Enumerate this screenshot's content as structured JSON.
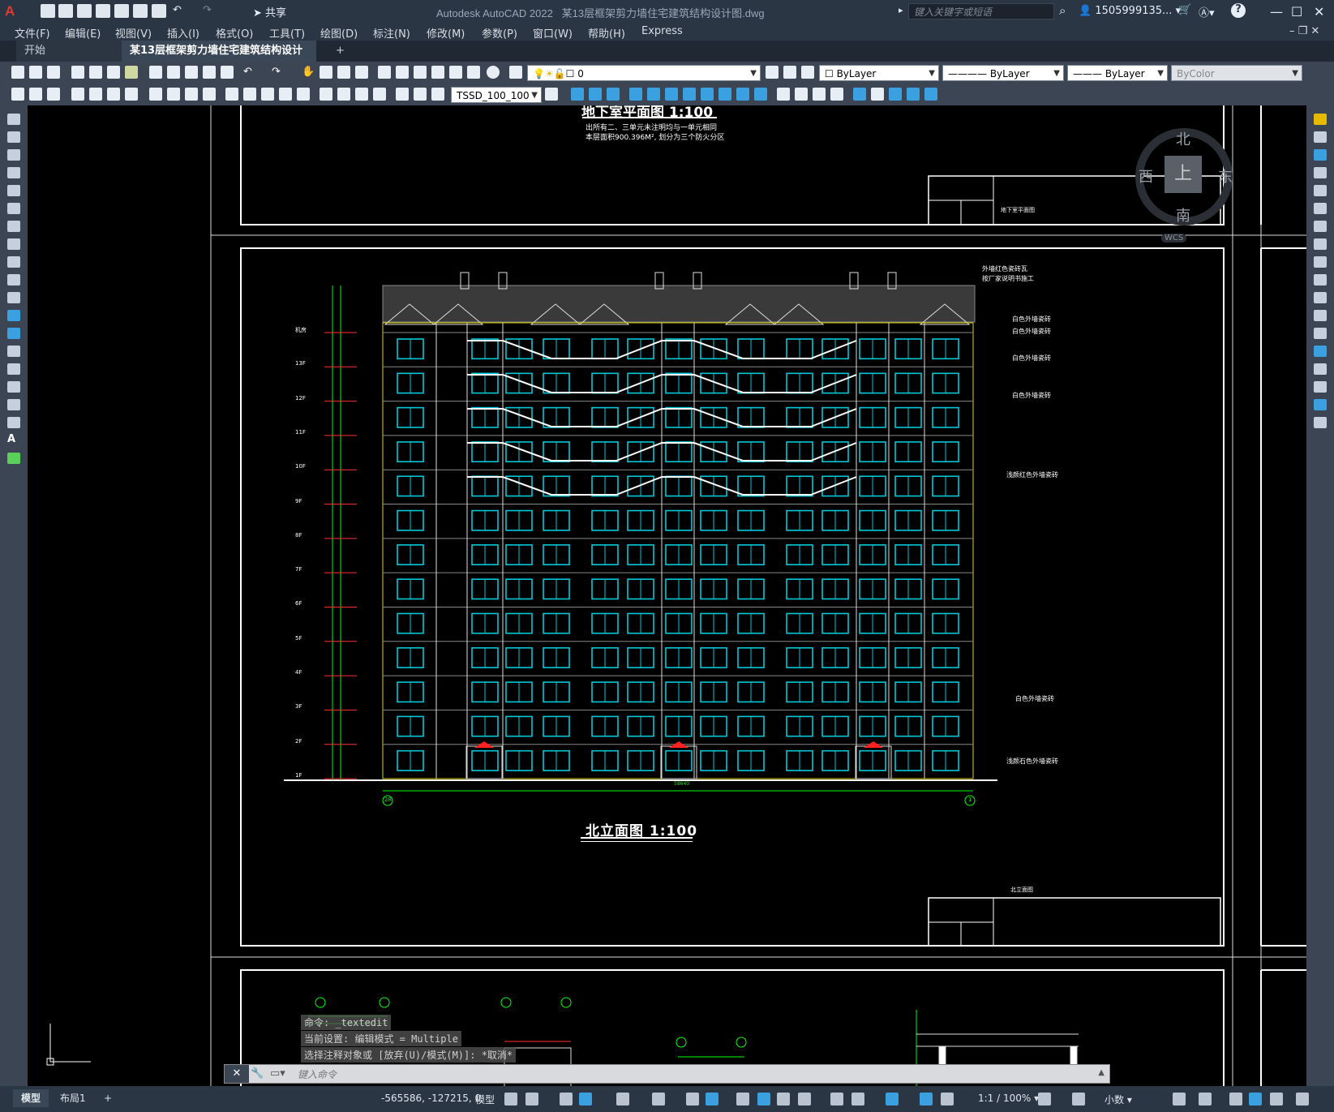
{
  "titlebar": {
    "logo": "A",
    "share": "共享",
    "app_title": "Autodesk AutoCAD 2022",
    "file_title": "某13层框架剪力墙住宅建筑结构设计图.dwg",
    "search_placeholder": "键入关键字或短语",
    "user": "1505999135...",
    "help": "?"
  },
  "menu": [
    "文件(F)",
    "编辑(E)",
    "视图(V)",
    "插入(I)",
    "格式(O)",
    "工具(T)",
    "绘图(D)",
    "标注(N)",
    "修改(M)",
    "参数(P)",
    "窗口(W)",
    "帮助(H)",
    "Express"
  ],
  "tabs": {
    "start": "开始",
    "doc": "某13层框架剪力墙住宅建筑结构设计图*",
    "add": "+"
  },
  "toolbar": {
    "layer_value": "0",
    "color": "ByLayer",
    "linetype": "ByLayer",
    "lineweight": "ByLayer",
    "plotstyle": "ByColor",
    "textstyle": "TSSD_100_100"
  },
  "viewcube": {
    "north": "北",
    "south": "南",
    "east": "东",
    "west": "西",
    "top": "上",
    "wcs": "WCS"
  },
  "drawing": {
    "top_title": "地下室平面图 1:100",
    "top_note1": "出所有二、三单元未注明均与一单元相同",
    "top_note2": "本层面积900.396M², 划分为三个防火分区",
    "elev_title": "北立面图 1:100",
    "annot1": "外墙红色瓷砖瓦",
    "annot2": "按厂家说明书施工",
    "annot3": "白色外墙瓷砖",
    "annot4": "白色外墙瓷砖",
    "annot5": "白色外墙瓷砖",
    "annot6": "白色外墙瓷砖",
    "annot7": "浅颜红色外墙瓷砖",
    "annot8": "白色外墙瓷砖",
    "annot9": "浅颜石色外墙瓷砖",
    "floors": [
      "机房",
      "13F",
      "12F",
      "11F",
      "10F",
      "9F",
      "8F",
      "7F",
      "6F",
      "5F",
      "4F",
      "3F",
      "2F",
      "1F"
    ],
    "title_block_name": "北立面图",
    "title_block_top": "地下室平面图",
    "total_dim": "58640",
    "axis_left": "28",
    "axis_right": "1"
  },
  "command": {
    "line1": "命令: _textedit",
    "line2": "当前设置: 编辑模式 = Multiple",
    "line3": "选择注释对象或 [放弃(U)/模式(M)]: *取消*",
    "input_placeholder": "键入命令"
  },
  "status": {
    "tab_model": "模型",
    "tab_layout": "布局1",
    "coords": "-565586, -127215, 0",
    "model": "模型",
    "scale": "1:1 / 100%",
    "units": "小数"
  },
  "colors": {
    "accent": "#2b3645",
    "window_cyan": "#00c8d8",
    "dim_green": "#00ff00",
    "border_white": "#ffffff",
    "roof_gray": "#888888",
    "red_marker": "#ff2020"
  }
}
